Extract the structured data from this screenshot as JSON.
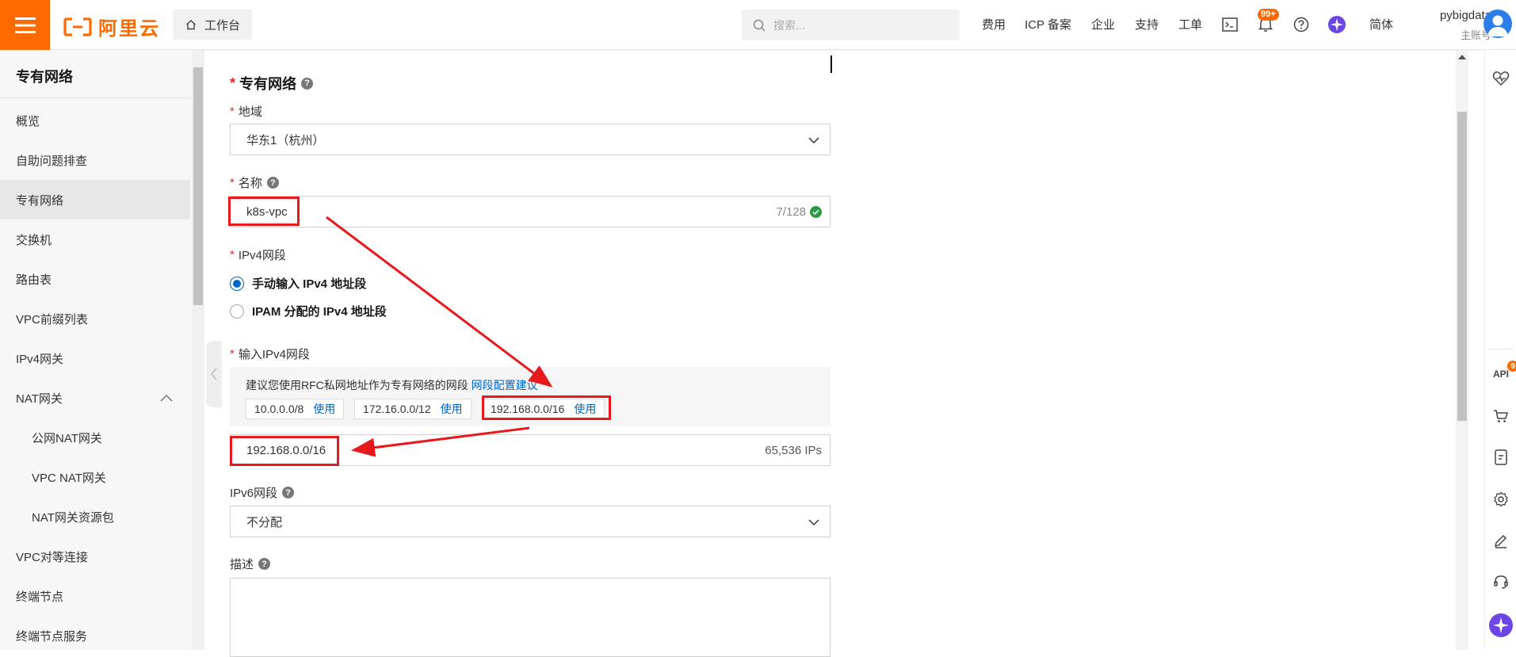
{
  "topbar": {
    "logo_text": "阿里云",
    "workbench_label": "工作台",
    "search_placeholder": "搜索...",
    "nav": [
      "费用",
      "ICP 备案",
      "企业",
      "支持",
      "工单"
    ],
    "notification_count": "99+",
    "language": "简体",
    "username": "pybigdata",
    "account_type": "主账号"
  },
  "sidebar": {
    "title": "专有网络",
    "items": [
      {
        "label": "概览"
      },
      {
        "label": "自助问题排查"
      },
      {
        "label": "专有网络",
        "active": true
      },
      {
        "label": "交换机"
      },
      {
        "label": "路由表"
      },
      {
        "label": "VPC前缀列表"
      },
      {
        "label": "IPv4网关"
      },
      {
        "label": "NAT网关",
        "expanded": true
      },
      {
        "label": "公网NAT网关",
        "sub": true
      },
      {
        "label": "VPC NAT网关",
        "sub": true
      },
      {
        "label": "NAT网关资源包",
        "sub": true
      },
      {
        "label": "VPC对等连接"
      },
      {
        "label": "终端节点"
      },
      {
        "label": "终端节点服务"
      }
    ]
  },
  "form": {
    "section_title": "专有网络",
    "region_label": "地域",
    "region_value": "华东1（杭州）",
    "name_label": "名称",
    "name_value": "k8s-vpc",
    "name_counter": "7/128",
    "ipv4_label": "IPv4网段",
    "ipv4_options": [
      "手动输入 IPv4 地址段",
      "IPAM 分配的 IPv4 地址段"
    ],
    "ipv4_selected_index": 0,
    "input_ipv4_label": "输入IPv4网段",
    "suggest_text": "建议您使用RFC私网地址作为专有网络的网段",
    "suggest_link": "网段配置建议",
    "cidr_suggestions": [
      "10.0.0.0/8",
      "172.16.0.0/12",
      "192.168.0.0/16"
    ],
    "use_label": "使用",
    "ipv4_value": "192.168.0.0/16",
    "ipv4_ip_count": "65,536 IPs",
    "ipv6_label": "IPv6网段",
    "ipv6_value": "不分配",
    "desc_label": "描述",
    "desc_value": ""
  },
  "rightbar": {
    "api_label": "API",
    "api_badge": "9"
  },
  "colors": {
    "brand": "#ff6a00",
    "link": "#0064c8",
    "required": "#d93026",
    "annotation": "#e8191d"
  }
}
